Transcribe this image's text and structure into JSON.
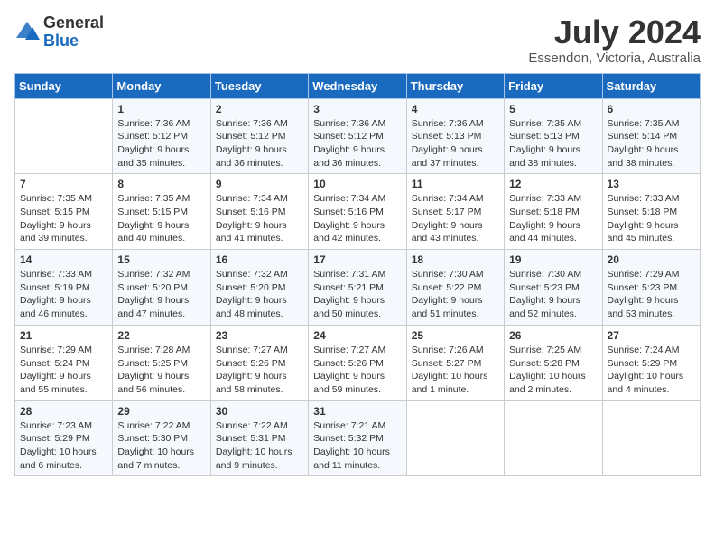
{
  "header": {
    "logo_general": "General",
    "logo_blue": "Blue",
    "month_year": "July 2024",
    "location": "Essendon, Victoria, Australia"
  },
  "days_of_week": [
    "Sunday",
    "Monday",
    "Tuesday",
    "Wednesday",
    "Thursday",
    "Friday",
    "Saturday"
  ],
  "weeks": [
    [
      {
        "day": "",
        "info": ""
      },
      {
        "day": "1",
        "info": "Sunrise: 7:36 AM\nSunset: 5:12 PM\nDaylight: 9 hours\nand 35 minutes."
      },
      {
        "day": "2",
        "info": "Sunrise: 7:36 AM\nSunset: 5:12 PM\nDaylight: 9 hours\nand 36 minutes."
      },
      {
        "day": "3",
        "info": "Sunrise: 7:36 AM\nSunset: 5:12 PM\nDaylight: 9 hours\nand 36 minutes."
      },
      {
        "day": "4",
        "info": "Sunrise: 7:36 AM\nSunset: 5:13 PM\nDaylight: 9 hours\nand 37 minutes."
      },
      {
        "day": "5",
        "info": "Sunrise: 7:35 AM\nSunset: 5:13 PM\nDaylight: 9 hours\nand 38 minutes."
      },
      {
        "day": "6",
        "info": "Sunrise: 7:35 AM\nSunset: 5:14 PM\nDaylight: 9 hours\nand 38 minutes."
      }
    ],
    [
      {
        "day": "7",
        "info": "Sunrise: 7:35 AM\nSunset: 5:15 PM\nDaylight: 9 hours\nand 39 minutes."
      },
      {
        "day": "8",
        "info": "Sunrise: 7:35 AM\nSunset: 5:15 PM\nDaylight: 9 hours\nand 40 minutes."
      },
      {
        "day": "9",
        "info": "Sunrise: 7:34 AM\nSunset: 5:16 PM\nDaylight: 9 hours\nand 41 minutes."
      },
      {
        "day": "10",
        "info": "Sunrise: 7:34 AM\nSunset: 5:16 PM\nDaylight: 9 hours\nand 42 minutes."
      },
      {
        "day": "11",
        "info": "Sunrise: 7:34 AM\nSunset: 5:17 PM\nDaylight: 9 hours\nand 43 minutes."
      },
      {
        "day": "12",
        "info": "Sunrise: 7:33 AM\nSunset: 5:18 PM\nDaylight: 9 hours\nand 44 minutes."
      },
      {
        "day": "13",
        "info": "Sunrise: 7:33 AM\nSunset: 5:18 PM\nDaylight: 9 hours\nand 45 minutes."
      }
    ],
    [
      {
        "day": "14",
        "info": "Sunrise: 7:33 AM\nSunset: 5:19 PM\nDaylight: 9 hours\nand 46 minutes."
      },
      {
        "day": "15",
        "info": "Sunrise: 7:32 AM\nSunset: 5:20 PM\nDaylight: 9 hours\nand 47 minutes."
      },
      {
        "day": "16",
        "info": "Sunrise: 7:32 AM\nSunset: 5:20 PM\nDaylight: 9 hours\nand 48 minutes."
      },
      {
        "day": "17",
        "info": "Sunrise: 7:31 AM\nSunset: 5:21 PM\nDaylight: 9 hours\nand 50 minutes."
      },
      {
        "day": "18",
        "info": "Sunrise: 7:30 AM\nSunset: 5:22 PM\nDaylight: 9 hours\nand 51 minutes."
      },
      {
        "day": "19",
        "info": "Sunrise: 7:30 AM\nSunset: 5:23 PM\nDaylight: 9 hours\nand 52 minutes."
      },
      {
        "day": "20",
        "info": "Sunrise: 7:29 AM\nSunset: 5:23 PM\nDaylight: 9 hours\nand 53 minutes."
      }
    ],
    [
      {
        "day": "21",
        "info": "Sunrise: 7:29 AM\nSunset: 5:24 PM\nDaylight: 9 hours\nand 55 minutes."
      },
      {
        "day": "22",
        "info": "Sunrise: 7:28 AM\nSunset: 5:25 PM\nDaylight: 9 hours\nand 56 minutes."
      },
      {
        "day": "23",
        "info": "Sunrise: 7:27 AM\nSunset: 5:26 PM\nDaylight: 9 hours\nand 58 minutes."
      },
      {
        "day": "24",
        "info": "Sunrise: 7:27 AM\nSunset: 5:26 PM\nDaylight: 9 hours\nand 59 minutes."
      },
      {
        "day": "25",
        "info": "Sunrise: 7:26 AM\nSunset: 5:27 PM\nDaylight: 10 hours\nand 1 minute."
      },
      {
        "day": "26",
        "info": "Sunrise: 7:25 AM\nSunset: 5:28 PM\nDaylight: 10 hours\nand 2 minutes."
      },
      {
        "day": "27",
        "info": "Sunrise: 7:24 AM\nSunset: 5:29 PM\nDaylight: 10 hours\nand 4 minutes."
      }
    ],
    [
      {
        "day": "28",
        "info": "Sunrise: 7:23 AM\nSunset: 5:29 PM\nDaylight: 10 hours\nand 6 minutes."
      },
      {
        "day": "29",
        "info": "Sunrise: 7:22 AM\nSunset: 5:30 PM\nDaylight: 10 hours\nand 7 minutes."
      },
      {
        "day": "30",
        "info": "Sunrise: 7:22 AM\nSunset: 5:31 PM\nDaylight: 10 hours\nand 9 minutes."
      },
      {
        "day": "31",
        "info": "Sunrise: 7:21 AM\nSunset: 5:32 PM\nDaylight: 10 hours\nand 11 minutes."
      },
      {
        "day": "",
        "info": ""
      },
      {
        "day": "",
        "info": ""
      },
      {
        "day": "",
        "info": ""
      }
    ]
  ]
}
